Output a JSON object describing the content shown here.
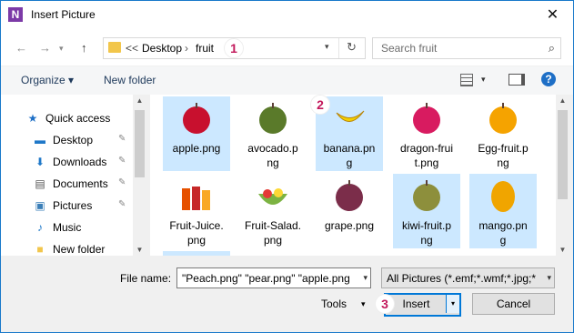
{
  "window": {
    "title": "Insert Picture",
    "app_icon_letter": "N",
    "close_glyph": "✕"
  },
  "nav": {
    "back_glyph": "←",
    "forward_glyph": "→",
    "up_glyph": "↑",
    "refresh_glyph": "↻"
  },
  "address": {
    "prefix": "<<",
    "crumbs": [
      "Desktop",
      "fruit"
    ],
    "separator": "›"
  },
  "search": {
    "placeholder": "Search fruit",
    "icon": "search-icon"
  },
  "toolbar": {
    "organize_label": "Organize ▾",
    "new_folder_label": "New folder",
    "help_glyph": "?"
  },
  "sidebar": {
    "items": [
      {
        "label": "Quick access",
        "icon": "star-icon",
        "glyph": "★",
        "color": "#1e6fc6",
        "pinned": false
      },
      {
        "label": "Desktop",
        "icon": "desktop-icon",
        "glyph": "▬",
        "color": "#1f78c8",
        "pinned": true
      },
      {
        "label": "Downloads",
        "icon": "download-icon",
        "glyph": "⬇",
        "color": "#1f78c8",
        "pinned": true
      },
      {
        "label": "Documents",
        "icon": "documents-icon",
        "glyph": "▤",
        "color": "#555555",
        "pinned": true
      },
      {
        "label": "Pictures",
        "icon": "pictures-icon",
        "glyph": "▣",
        "color": "#3b7fb8",
        "pinned": true
      },
      {
        "label": "Music",
        "icon": "music-icon",
        "glyph": "♪",
        "color": "#1f78c8",
        "pinned": false
      },
      {
        "label": "New folder",
        "icon": "folder-icon",
        "glyph": "■",
        "color": "#f2c64b",
        "pinned": false
      }
    ],
    "pin_glyph": "📌"
  },
  "files": [
    {
      "name": "apple.png",
      "selected": true,
      "color": "#c8102e",
      "shape": "round"
    },
    {
      "name": "avocado.p\nng",
      "selected": false,
      "color": "#5a7a2a",
      "shape": "round"
    },
    {
      "name": "banana.pn\ng",
      "selected": true,
      "color": "#f4d000",
      "shape": "banana"
    },
    {
      "name": "dragon-frui\nt.png",
      "selected": false,
      "color": "#d81b60",
      "shape": "round"
    },
    {
      "name": "Egg-fruit.p\nng",
      "selected": false,
      "color": "#f5a300",
      "shape": "round"
    },
    {
      "name": "Fruit-Juice.\npng",
      "selected": false,
      "color": "#e65100",
      "shape": "bottles"
    },
    {
      "name": "Fruit-Salad.\npng",
      "selected": false,
      "color": "#7cb342",
      "shape": "bowl"
    },
    {
      "name": "grape.png",
      "selected": false,
      "color": "#7b2d4a",
      "shape": "round"
    },
    {
      "name": "kiwi-fruit.p\nng",
      "selected": true,
      "color": "#8d8f3c",
      "shape": "round"
    },
    {
      "name": "mango.pn\ng",
      "selected": true,
      "color": "#f0a500",
      "shape": "oval"
    }
  ],
  "partial_row_selected": [
    true,
    false,
    false,
    false,
    false
  ],
  "bottom": {
    "filename_label": "File name:",
    "filename_value": "\"Peach.png\" \"pear.png\" \"apple.png\"",
    "filter_value": "All Pictures (*.emf;*.wmf;*.jpg;*",
    "tools_label": "Tools",
    "insert_label": "Insert",
    "cancel_label": "Cancel"
  },
  "badges": [
    "1",
    "2",
    "3"
  ],
  "colors": {
    "accent": "#0078d7",
    "selection": "#cce8ff",
    "badge": "#c2185b"
  }
}
